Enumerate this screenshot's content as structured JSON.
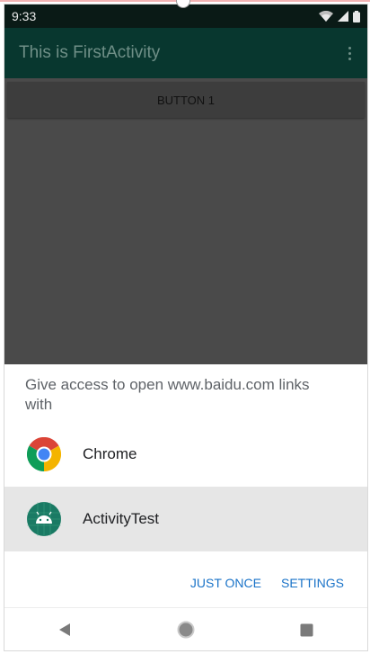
{
  "status_bar": {
    "time": "9:33"
  },
  "app_bar": {
    "title": "This is FirstActivity"
  },
  "content": {
    "button_label": "BUTTON 1"
  },
  "chooser": {
    "title": "Give access to open www.baidu.com links with",
    "apps": [
      {
        "label": "Chrome",
        "icon": "chrome-icon"
      },
      {
        "label": "ActivityTest",
        "icon": "android-icon"
      }
    ],
    "actions": {
      "just_once": "JUST ONCE",
      "settings": "SETTINGS"
    }
  },
  "colors": {
    "status_bar": "#0a1a16",
    "app_bar": "#08372f",
    "scrim": "#4a4a4a",
    "action_blue": "#1a73c8",
    "selected_row": "#e6e6e6",
    "android_icon_bg": "#1a7a64"
  },
  "nav": {
    "icons": [
      "back-icon",
      "home-icon",
      "recents-icon"
    ]
  }
}
